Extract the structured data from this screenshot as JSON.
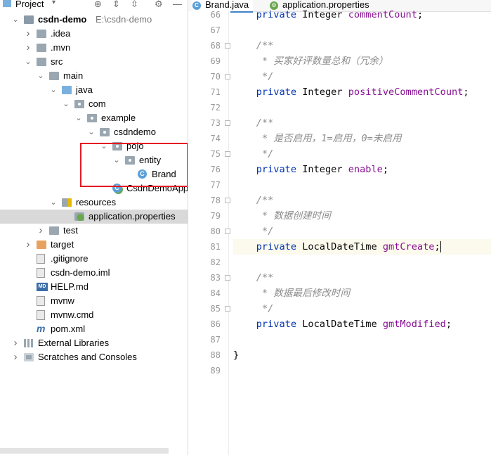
{
  "project_panel": {
    "title": "Project",
    "tree": [
      {
        "label": "csdn-demo",
        "path": "E:\\csdn-demo",
        "indent": 0,
        "arrow": "open",
        "icon": "module-folder-icon"
      },
      {
        "label": ".idea",
        "indent": 1,
        "arrow": "closed",
        "icon": "folder-icon"
      },
      {
        "label": ".mvn",
        "indent": 1,
        "arrow": "closed",
        "icon": "folder-icon"
      },
      {
        "label": "src",
        "indent": 1,
        "arrow": "open",
        "icon": "folder-icon"
      },
      {
        "label": "main",
        "indent": 2,
        "arrow": "open",
        "icon": "folder-icon"
      },
      {
        "label": "java",
        "indent": 3,
        "arrow": "open",
        "icon": "source-folder-icon"
      },
      {
        "label": "com",
        "indent": 4,
        "arrow": "open",
        "icon": "package-icon"
      },
      {
        "label": "example",
        "indent": 5,
        "arrow": "open",
        "icon": "package-icon"
      },
      {
        "label": "csdndemo",
        "indent": 6,
        "arrow": "open",
        "icon": "package-icon"
      },
      {
        "label": "pojo",
        "indent": 7,
        "arrow": "open",
        "icon": "package-icon"
      },
      {
        "label": "entity",
        "indent": 8,
        "arrow": "open",
        "icon": "package-icon"
      },
      {
        "label": "Brand",
        "indent": 9,
        "arrow": "none",
        "icon": "class-icon"
      },
      {
        "label": "CsdnDemoApplica",
        "indent": 7,
        "arrow": "none",
        "icon": "spring-boot-class-icon"
      },
      {
        "label": "resources",
        "indent": 3,
        "arrow": "open",
        "icon": "resources-folder-icon"
      },
      {
        "label": "application.properties",
        "indent": 4,
        "arrow": "none",
        "icon": "properties-icon",
        "selected": true
      },
      {
        "label": "test",
        "indent": 2,
        "arrow": "closed",
        "icon": "folder-icon"
      },
      {
        "label": "target",
        "indent": 1,
        "arrow": "closed",
        "icon": "excluded-folder-icon"
      },
      {
        "label": ".gitignore",
        "indent": 1,
        "arrow": "none",
        "icon": "gitignore-file-icon"
      },
      {
        "label": "csdn-demo.iml",
        "indent": 1,
        "arrow": "none",
        "icon": "iml-file-icon"
      },
      {
        "label": "HELP.md",
        "indent": 1,
        "arrow": "none",
        "icon": "markdown-file-icon"
      },
      {
        "label": "mvnw",
        "indent": 1,
        "arrow": "none",
        "icon": "file-icon"
      },
      {
        "label": "mvnw.cmd",
        "indent": 1,
        "arrow": "none",
        "icon": "file-icon"
      },
      {
        "label": "pom.xml",
        "indent": 1,
        "arrow": "none",
        "icon": "maven-icon"
      },
      {
        "label": "External Libraries",
        "indent": 0,
        "arrow": "closed",
        "icon": "libraries-icon"
      },
      {
        "label": "Scratches and Consoles",
        "indent": 0,
        "arrow": "closed",
        "icon": "scratches-icon"
      }
    ]
  },
  "editor": {
    "tabs": [
      {
        "label": "Brand.java",
        "icon": "class-icon",
        "active": true
      },
      {
        "label": "application.properties",
        "icon": "properties-icon",
        "active": false
      }
    ],
    "lines": [
      {
        "num": "66",
        "indent": "    ",
        "tokens": [
          [
            "kw",
            "private "
          ],
          [
            "",
            "Integer "
          ],
          [
            "fld",
            "commentCount"
          ],
          [
            "",
            ";"
          ]
        ]
      },
      {
        "num": "67",
        "indent": "",
        "tokens": []
      },
      {
        "num": "68",
        "indent": "    ",
        "tokens": [
          [
            "cmt",
            "/**"
          ]
        ],
        "fold": true
      },
      {
        "num": "69",
        "indent": "     ",
        "tokens": [
          [
            "cmt",
            "* 买家好评数量总和（冗余）"
          ]
        ]
      },
      {
        "num": "70",
        "indent": "     ",
        "tokens": [
          [
            "cmt",
            "*/"
          ]
        ],
        "fold": true
      },
      {
        "num": "71",
        "indent": "    ",
        "tokens": [
          [
            "kw",
            "private "
          ],
          [
            "",
            "Integer "
          ],
          [
            "fld",
            "positiveCommentCount"
          ],
          [
            "",
            ";"
          ]
        ]
      },
      {
        "num": "72",
        "indent": "",
        "tokens": []
      },
      {
        "num": "73",
        "indent": "    ",
        "tokens": [
          [
            "cmt",
            "/**"
          ]
        ],
        "fold": true
      },
      {
        "num": "74",
        "indent": "     ",
        "tokens": [
          [
            "cmt",
            "* 是否启用，1=启用，0=未启用"
          ]
        ]
      },
      {
        "num": "75",
        "indent": "     ",
        "tokens": [
          [
            "cmt",
            "*/"
          ]
        ],
        "fold": true
      },
      {
        "num": "76",
        "indent": "    ",
        "tokens": [
          [
            "kw",
            "private "
          ],
          [
            "",
            "Integer "
          ],
          [
            "fld",
            "enable"
          ],
          [
            "",
            ";"
          ]
        ]
      },
      {
        "num": "77",
        "indent": "",
        "tokens": []
      },
      {
        "num": "78",
        "indent": "    ",
        "tokens": [
          [
            "cmt",
            "/**"
          ]
        ],
        "fold": true
      },
      {
        "num": "79",
        "indent": "     ",
        "tokens": [
          [
            "cmt",
            "* 数据创建时间"
          ]
        ]
      },
      {
        "num": "80",
        "indent": "     ",
        "tokens": [
          [
            "cmt",
            "*/"
          ]
        ],
        "fold": true
      },
      {
        "num": "81",
        "indent": "    ",
        "tokens": [
          [
            "kw",
            "private "
          ],
          [
            "",
            "LocalDateTime "
          ],
          [
            "fld",
            "gmtCreate"
          ],
          [
            "",
            ";"
          ]
        ],
        "current": true
      },
      {
        "num": "82",
        "indent": "",
        "tokens": []
      },
      {
        "num": "83",
        "indent": "    ",
        "tokens": [
          [
            "cmt",
            "/**"
          ]
        ],
        "fold": true
      },
      {
        "num": "84",
        "indent": "     ",
        "tokens": [
          [
            "cmt",
            "* 数据最后修改时间"
          ]
        ]
      },
      {
        "num": "85",
        "indent": "     ",
        "tokens": [
          [
            "cmt",
            "*/"
          ]
        ],
        "fold": true
      },
      {
        "num": "86",
        "indent": "    ",
        "tokens": [
          [
            "kw",
            "private "
          ],
          [
            "",
            "LocalDateTime "
          ],
          [
            "fld",
            "gmtModified"
          ],
          [
            "",
            ";"
          ]
        ]
      },
      {
        "num": "87",
        "indent": "",
        "tokens": []
      },
      {
        "num": "88",
        "indent": "",
        "tokens": [
          [
            "",
            "}"
          ]
        ]
      },
      {
        "num": "89",
        "indent": "",
        "tokens": []
      }
    ]
  },
  "colors": {
    "highlight_box": "#e41b23",
    "selection": "#d9d9d9",
    "keyword": "#0033b3",
    "field": "#871094",
    "comment": "#8c8c8c"
  }
}
